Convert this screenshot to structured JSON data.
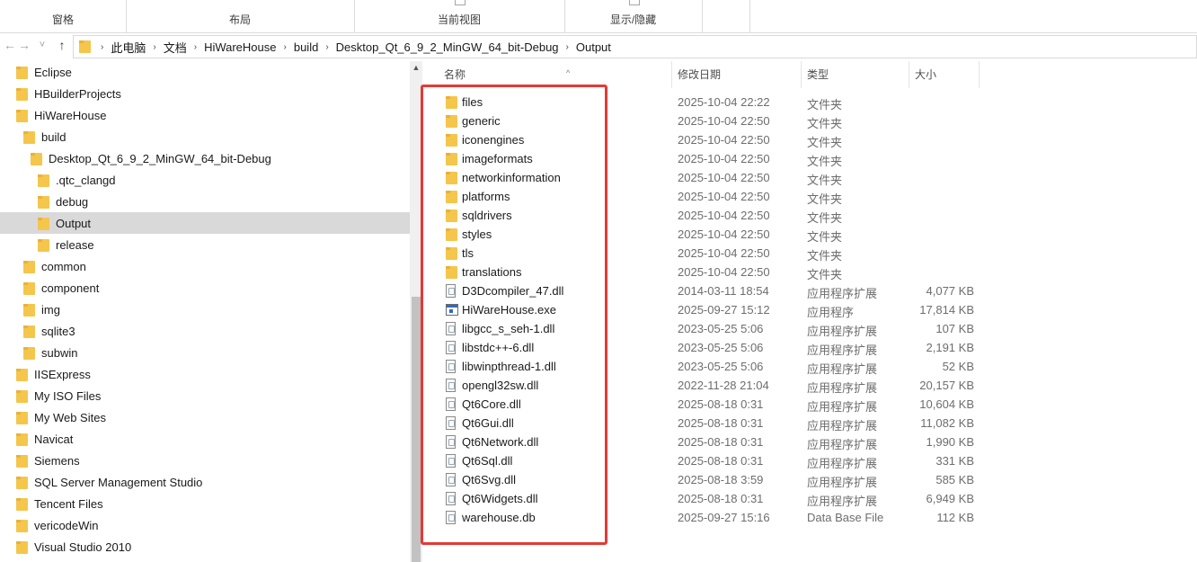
{
  "ribbon": {
    "groups": [
      "窗格",
      "布局",
      "当前视图",
      "显示/隐藏"
    ]
  },
  "nav": {
    "back_icon": "←",
    "forward_icon": "→",
    "history_icon": "˅",
    "up_icon": "↑",
    "breadcrumb": [
      "此电脑",
      "文档",
      "HiWareHouse",
      "build",
      "Desktop_Qt_6_9_2_MinGW_64_bit-Debug",
      "Output"
    ],
    "separator": "›"
  },
  "tree": [
    {
      "label": "Eclipse",
      "indent": 0
    },
    {
      "label": "HBuilderProjects",
      "indent": 0
    },
    {
      "label": "HiWareHouse",
      "indent": 0
    },
    {
      "label": "build",
      "indent": 1
    },
    {
      "label": "Desktop_Qt_6_9_2_MinGW_64_bit-Debug",
      "indent": 2
    },
    {
      "label": ".qtc_clangd",
      "indent": 3
    },
    {
      "label": "debug",
      "indent": 3
    },
    {
      "label": "Output",
      "indent": 3,
      "selected": true
    },
    {
      "label": "release",
      "indent": 3
    },
    {
      "label": "common",
      "indent": 1
    },
    {
      "label": "component",
      "indent": 1
    },
    {
      "label": "img",
      "indent": 1
    },
    {
      "label": "sqlite3",
      "indent": 1
    },
    {
      "label": "subwin",
      "indent": 1
    },
    {
      "label": "IISExpress",
      "indent": 0
    },
    {
      "label": "My ISO Files",
      "indent": 0
    },
    {
      "label": "My Web Sites",
      "indent": 0
    },
    {
      "label": "Navicat",
      "indent": 0
    },
    {
      "label": "Siemens",
      "indent": 0
    },
    {
      "label": "SQL Server Management Studio",
      "indent": 0
    },
    {
      "label": "Tencent Files",
      "indent": 0
    },
    {
      "label": "vericodeWin",
      "indent": 0
    },
    {
      "label": "Visual Studio 2010",
      "indent": 0
    }
  ],
  "columns": {
    "name": "名称",
    "date": "修改日期",
    "type": "类型",
    "size": "大小"
  },
  "files": [
    {
      "name": "files",
      "date": "2025-10-04 22:22",
      "type": "文件夹",
      "size": "",
      "icon": "folder"
    },
    {
      "name": "generic",
      "date": "2025-10-04 22:50",
      "type": "文件夹",
      "size": "",
      "icon": "folder"
    },
    {
      "name": "iconengines",
      "date": "2025-10-04 22:50",
      "type": "文件夹",
      "size": "",
      "icon": "folder"
    },
    {
      "name": "imageformats",
      "date": "2025-10-04 22:50",
      "type": "文件夹",
      "size": "",
      "icon": "folder"
    },
    {
      "name": "networkinformation",
      "date": "2025-10-04 22:50",
      "type": "文件夹",
      "size": "",
      "icon": "folder"
    },
    {
      "name": "platforms",
      "date": "2025-10-04 22:50",
      "type": "文件夹",
      "size": "",
      "icon": "folder"
    },
    {
      "name": "sqldrivers",
      "date": "2025-10-04 22:50",
      "type": "文件夹",
      "size": "",
      "icon": "folder"
    },
    {
      "name": "styles",
      "date": "2025-10-04 22:50",
      "type": "文件夹",
      "size": "",
      "icon": "folder"
    },
    {
      "name": "tls",
      "date": "2025-10-04 22:50",
      "type": "文件夹",
      "size": "",
      "icon": "folder"
    },
    {
      "name": "translations",
      "date": "2025-10-04 22:50",
      "type": "文件夹",
      "size": "",
      "icon": "folder"
    },
    {
      "name": "D3Dcompiler_47.dll",
      "date": "2014-03-11 18:54",
      "type": "应用程序扩展",
      "size": "4,077 KB",
      "icon": "dll"
    },
    {
      "name": "HiWareHouse.exe",
      "date": "2025-09-27 15:12",
      "type": "应用程序",
      "size": "17,814 KB",
      "icon": "exe"
    },
    {
      "name": "libgcc_s_seh-1.dll",
      "date": "2023-05-25 5:06",
      "type": "应用程序扩展",
      "size": "107 KB",
      "icon": "dll"
    },
    {
      "name": "libstdc++-6.dll",
      "date": "2023-05-25 5:06",
      "type": "应用程序扩展",
      "size": "2,191 KB",
      "icon": "dll"
    },
    {
      "name": "libwinpthread-1.dll",
      "date": "2023-05-25 5:06",
      "type": "应用程序扩展",
      "size": "52 KB",
      "icon": "dll"
    },
    {
      "name": "opengl32sw.dll",
      "date": "2022-11-28 21:04",
      "type": "应用程序扩展",
      "size": "20,157 KB",
      "icon": "dll"
    },
    {
      "name": "Qt6Core.dll",
      "date": "2025-08-18 0:31",
      "type": "应用程序扩展",
      "size": "10,604 KB",
      "icon": "dll"
    },
    {
      "name": "Qt6Gui.dll",
      "date": "2025-08-18 0:31",
      "type": "应用程序扩展",
      "size": "11,082 KB",
      "icon": "dll"
    },
    {
      "name": "Qt6Network.dll",
      "date": "2025-08-18 0:31",
      "type": "应用程序扩展",
      "size": "1,990 KB",
      "icon": "dll"
    },
    {
      "name": "Qt6Sql.dll",
      "date": "2025-08-18 0:31",
      "type": "应用程序扩展",
      "size": "331 KB",
      "icon": "dll"
    },
    {
      "name": "Qt6Svg.dll",
      "date": "2025-08-18 3:59",
      "type": "应用程序扩展",
      "size": "585 KB",
      "icon": "dll"
    },
    {
      "name": "Qt6Widgets.dll",
      "date": "2025-08-18 0:31",
      "type": "应用程序扩展",
      "size": "6,949 KB",
      "icon": "dll"
    },
    {
      "name": "warehouse.db",
      "date": "2025-09-27 15:16",
      "type": "Data Base File",
      "size": "112 KB",
      "icon": "db"
    }
  ],
  "colors": {
    "highlight_border": "#e53935",
    "folder": "#f5c64c",
    "selected_row": "#d9d9d9"
  }
}
